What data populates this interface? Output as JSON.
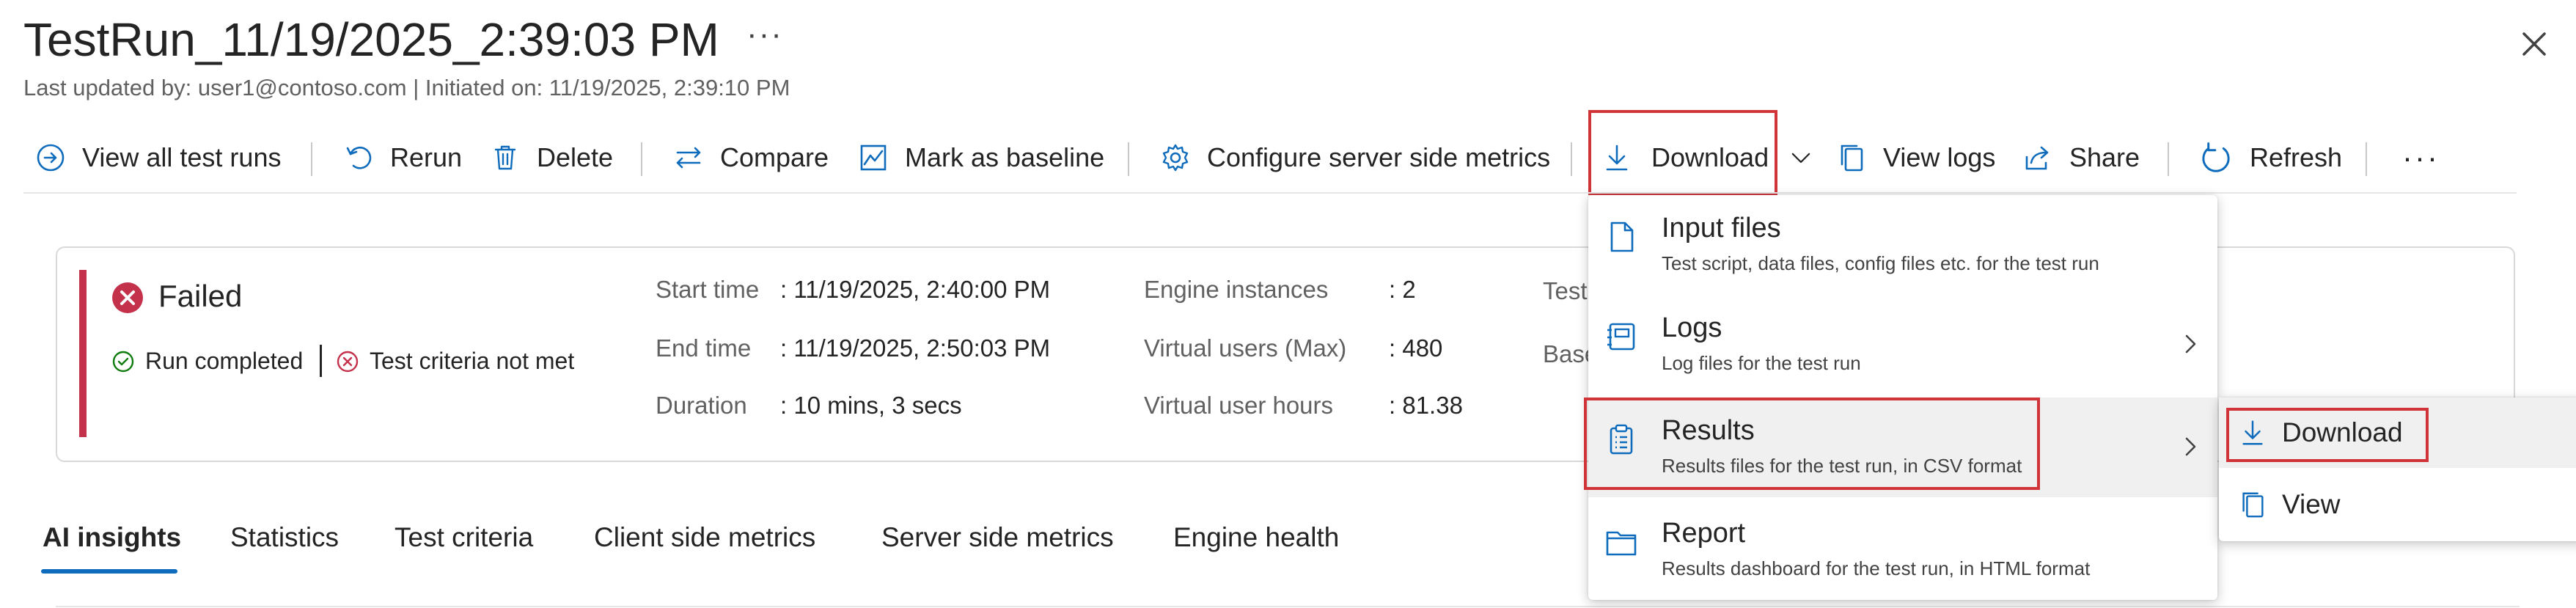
{
  "header": {
    "title": "TestRun_11/19/2025_2:39:03 PM",
    "more_label": "···",
    "subtitle": "Last updated by: user1@contoso.com | Initiated on: 11/19/2025, 2:39:10 PM"
  },
  "toolbar": {
    "view_all": "View all test runs",
    "rerun": "Rerun",
    "delete": "Delete",
    "compare": "Compare",
    "mark_baseline": "Mark as baseline",
    "configure_metrics": "Configure server side metrics",
    "download": "Download",
    "view_logs": "View logs",
    "share": "Share",
    "refresh": "Refresh",
    "more": "···"
  },
  "summary": {
    "status": "Failed",
    "run_status": "Run completed",
    "criteria_status": "Test criteria not met",
    "col1": [
      {
        "label": "Start time",
        "value": ": 11/19/2025, 2:40:00 PM"
      },
      {
        "label": "End time",
        "value": ": 11/19/2025, 2:50:03 PM"
      },
      {
        "label": "Duration",
        "value": ": 10 mins, 3 secs"
      }
    ],
    "col2": [
      {
        "label": "Engine instances",
        "value": ": 2"
      },
      {
        "label": "Virtual users (Max)",
        "value": ": 480"
      },
      {
        "label": "Virtual user hours",
        "value": ": 81.38"
      }
    ],
    "col3_partial": [
      "Test",
      "Base"
    ]
  },
  "tabs": [
    "AI insights",
    "Statistics",
    "Test criteria",
    "Client side metrics",
    "Server side metrics",
    "Engine health"
  ],
  "download_menu": [
    {
      "title": "Input files",
      "desc": "Test script, data files, config files etc. for the test run",
      "icon": "file-icon"
    },
    {
      "title": "Logs",
      "desc": "Log files for the test run",
      "icon": "notebook-icon"
    },
    {
      "title": "Results",
      "desc": "Results files for the test run, in CSV format",
      "icon": "clipboard-icon"
    },
    {
      "title": "Report",
      "desc": "Results dashboard for the test run, in HTML format",
      "icon": "folder-icon"
    }
  ],
  "results_submenu": {
    "download": "Download",
    "view": "View"
  },
  "colors": {
    "accent": "#0f6cbd",
    "failed": "#c4314b",
    "success": "#107c10",
    "highlight_box": "#d13438"
  }
}
